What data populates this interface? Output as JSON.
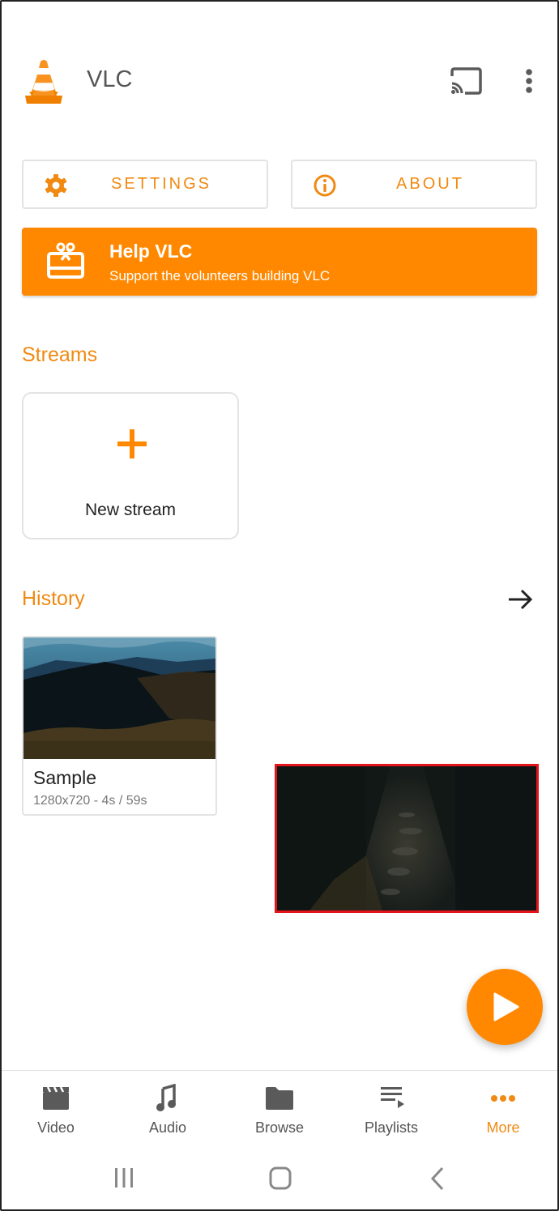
{
  "app_bar": {
    "title": "VLC",
    "logo_icon": "vlc-cone-icon",
    "cast_icon": "cast-icon",
    "menu_icon": "more-vert-icon"
  },
  "actions": {
    "settings_label": "SETTINGS",
    "settings_icon": "gear-icon",
    "about_label": "ABOUT",
    "about_icon": "info-icon"
  },
  "help_banner": {
    "title": "Help VLC",
    "subtitle": "Support the volunteers building VLC",
    "icon": "gift-card-icon"
  },
  "streams": {
    "title": "Streams",
    "new_stream_label": "New stream",
    "new_stream_icon": "plus-icon"
  },
  "history": {
    "title": "History",
    "arrow_icon": "arrow-right-icon",
    "items": [
      {
        "name": "Sample",
        "meta": "1280x720 - 4s / 59s"
      }
    ]
  },
  "pip_player": {
    "highlight_color": "#e4141b"
  },
  "fab": {
    "icon": "play-icon"
  },
  "bottom_nav": {
    "items": [
      {
        "label": "Video",
        "icon": "clapperboard-icon",
        "active": false
      },
      {
        "label": "Audio",
        "icon": "music-note-icon",
        "active": false
      },
      {
        "label": "Browse",
        "icon": "folder-icon",
        "active": false
      },
      {
        "label": "Playlists",
        "icon": "playlist-play-icon",
        "active": false
      },
      {
        "label": "More",
        "icon": "more-horiz-icon",
        "active": true
      }
    ]
  },
  "system_nav": {
    "recents_icon": "recents-icon",
    "home_icon": "home-icon",
    "back_icon": "back-icon"
  },
  "colors": {
    "accent": "#ff8800",
    "accent_text": "#f08a12",
    "icon_gray": "#5a5a5a",
    "border": "#e3e3e3"
  }
}
